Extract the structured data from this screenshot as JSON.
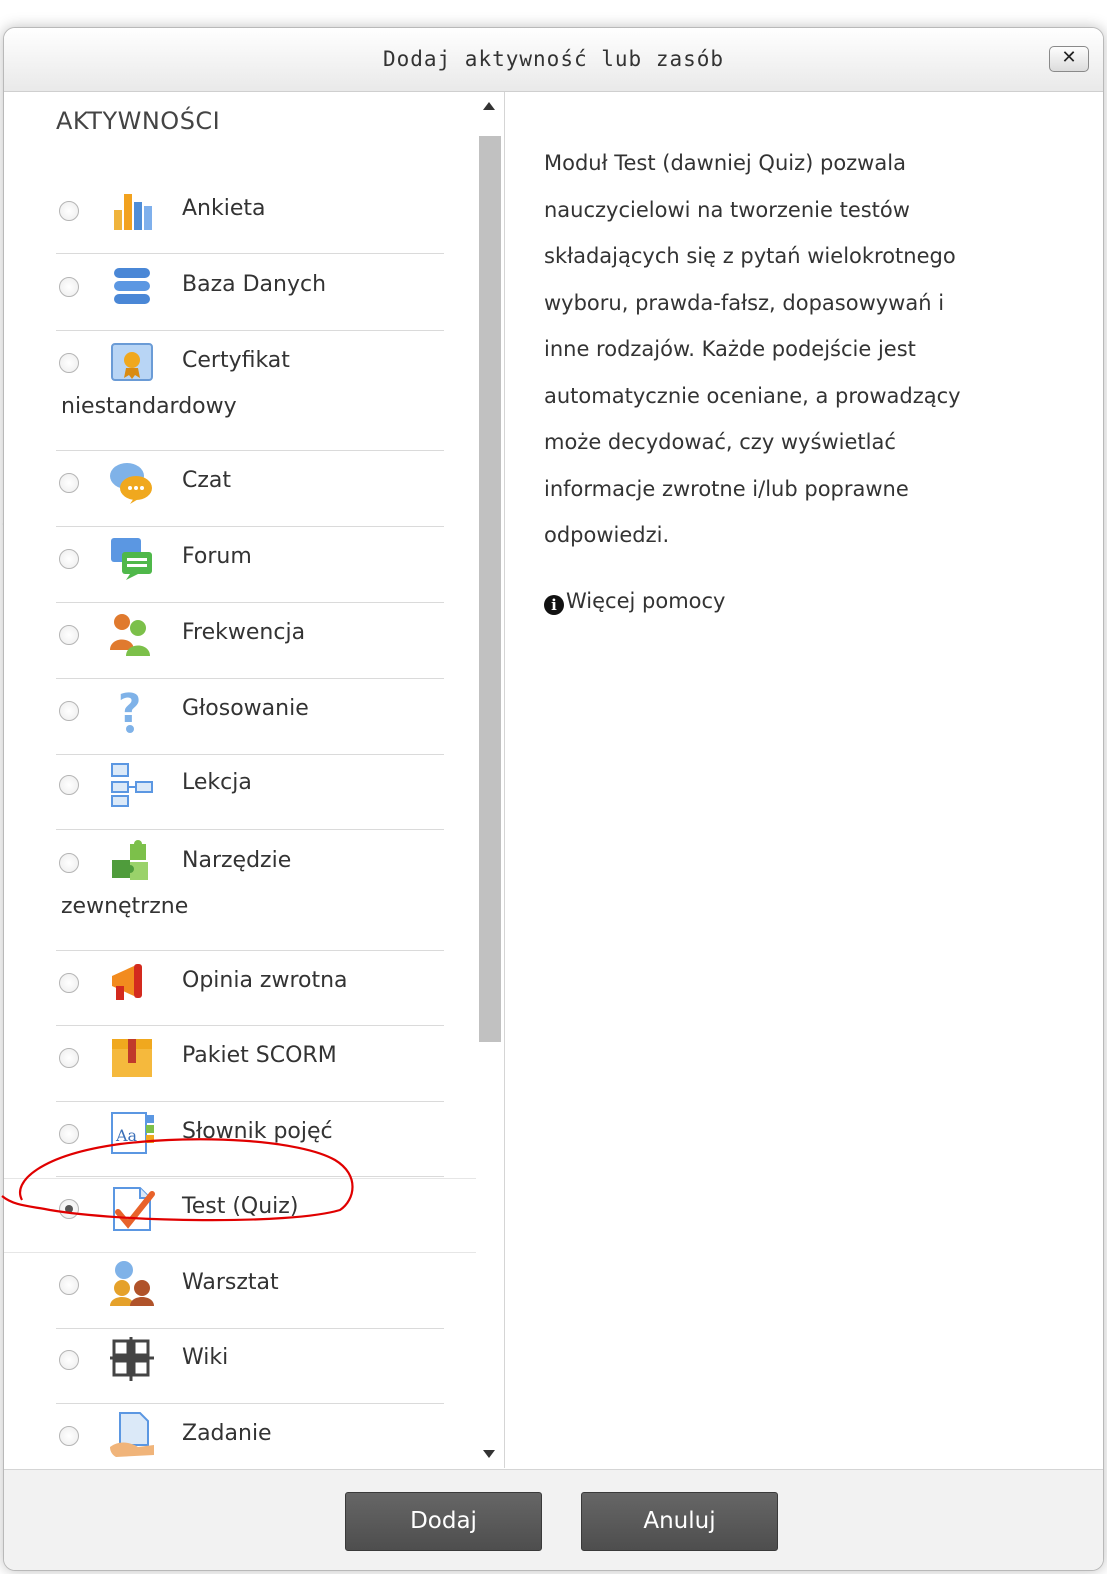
{
  "dialog": {
    "title": "Dodaj aktywność lub zasób",
    "close_label": "✕"
  },
  "activities": {
    "section_title": "AKTYWNOŚCI",
    "items": [
      {
        "label": "Ankieta",
        "label_cont": "",
        "icon": "survey-chart-icon",
        "checked": false
      },
      {
        "label": "Baza Danych",
        "label_cont": "",
        "icon": "database-icon",
        "checked": false
      },
      {
        "label": "Certyfikat",
        "label_cont": "niestandardowy",
        "icon": "certificate-icon",
        "checked": false
      },
      {
        "label": "Czat",
        "label_cont": "",
        "icon": "chat-icon",
        "checked": false
      },
      {
        "label": "Forum",
        "label_cont": "",
        "icon": "forum-icon",
        "checked": false
      },
      {
        "label": "Frekwencja",
        "label_cont": "",
        "icon": "attendance-icon",
        "checked": false
      },
      {
        "label": "Głosowanie",
        "label_cont": "",
        "icon": "question-icon",
        "checked": false
      },
      {
        "label": "Lekcja",
        "label_cont": "",
        "icon": "lesson-icon",
        "checked": false
      },
      {
        "label": "Narzędzie",
        "label_cont": "zewnętrzne",
        "icon": "puzzle-icon",
        "checked": false
      },
      {
        "label": "Opinia zwrotna",
        "label_cont": "",
        "icon": "megaphone-icon",
        "checked": false
      },
      {
        "label": "Pakiet SCORM",
        "label_cont": "",
        "icon": "package-icon",
        "checked": false
      },
      {
        "label": "Słownik pojęć",
        "label_cont": "",
        "icon": "glossary-icon",
        "checked": false
      },
      {
        "label": "Test (Quiz)",
        "label_cont": "",
        "icon": "quiz-check-icon",
        "checked": true
      },
      {
        "label": "Warsztat",
        "label_cont": "",
        "icon": "workshop-icon",
        "checked": false
      },
      {
        "label": "Wiki",
        "label_cont": "",
        "icon": "wiki-icon",
        "checked": false
      },
      {
        "label": "Zadanie",
        "label_cont": "",
        "icon": "assignment-icon",
        "checked": false
      }
    ]
  },
  "description": {
    "lines": [
      "Moduł Test (dawniej Quiz) pozwala",
      "nauczycielowi na tworzenie testów",
      "składających się z pytań wielokrotnego",
      "wyboru, prawda-fałsz, dopasowywań i",
      "inne rodzajów. Każde podejście jest",
      "automatycznie oceniane, a prowadzący",
      "może decydować, czy wyświetlać",
      "informacje zwrotne i/lub poprawne",
      "odpowiedzi."
    ],
    "help_label": "Więcej pomocy"
  },
  "footer": {
    "add_label": "Dodaj",
    "cancel_label": "Anuluj"
  },
  "colors": {
    "annotation": "#e00000",
    "button": "#595959"
  }
}
